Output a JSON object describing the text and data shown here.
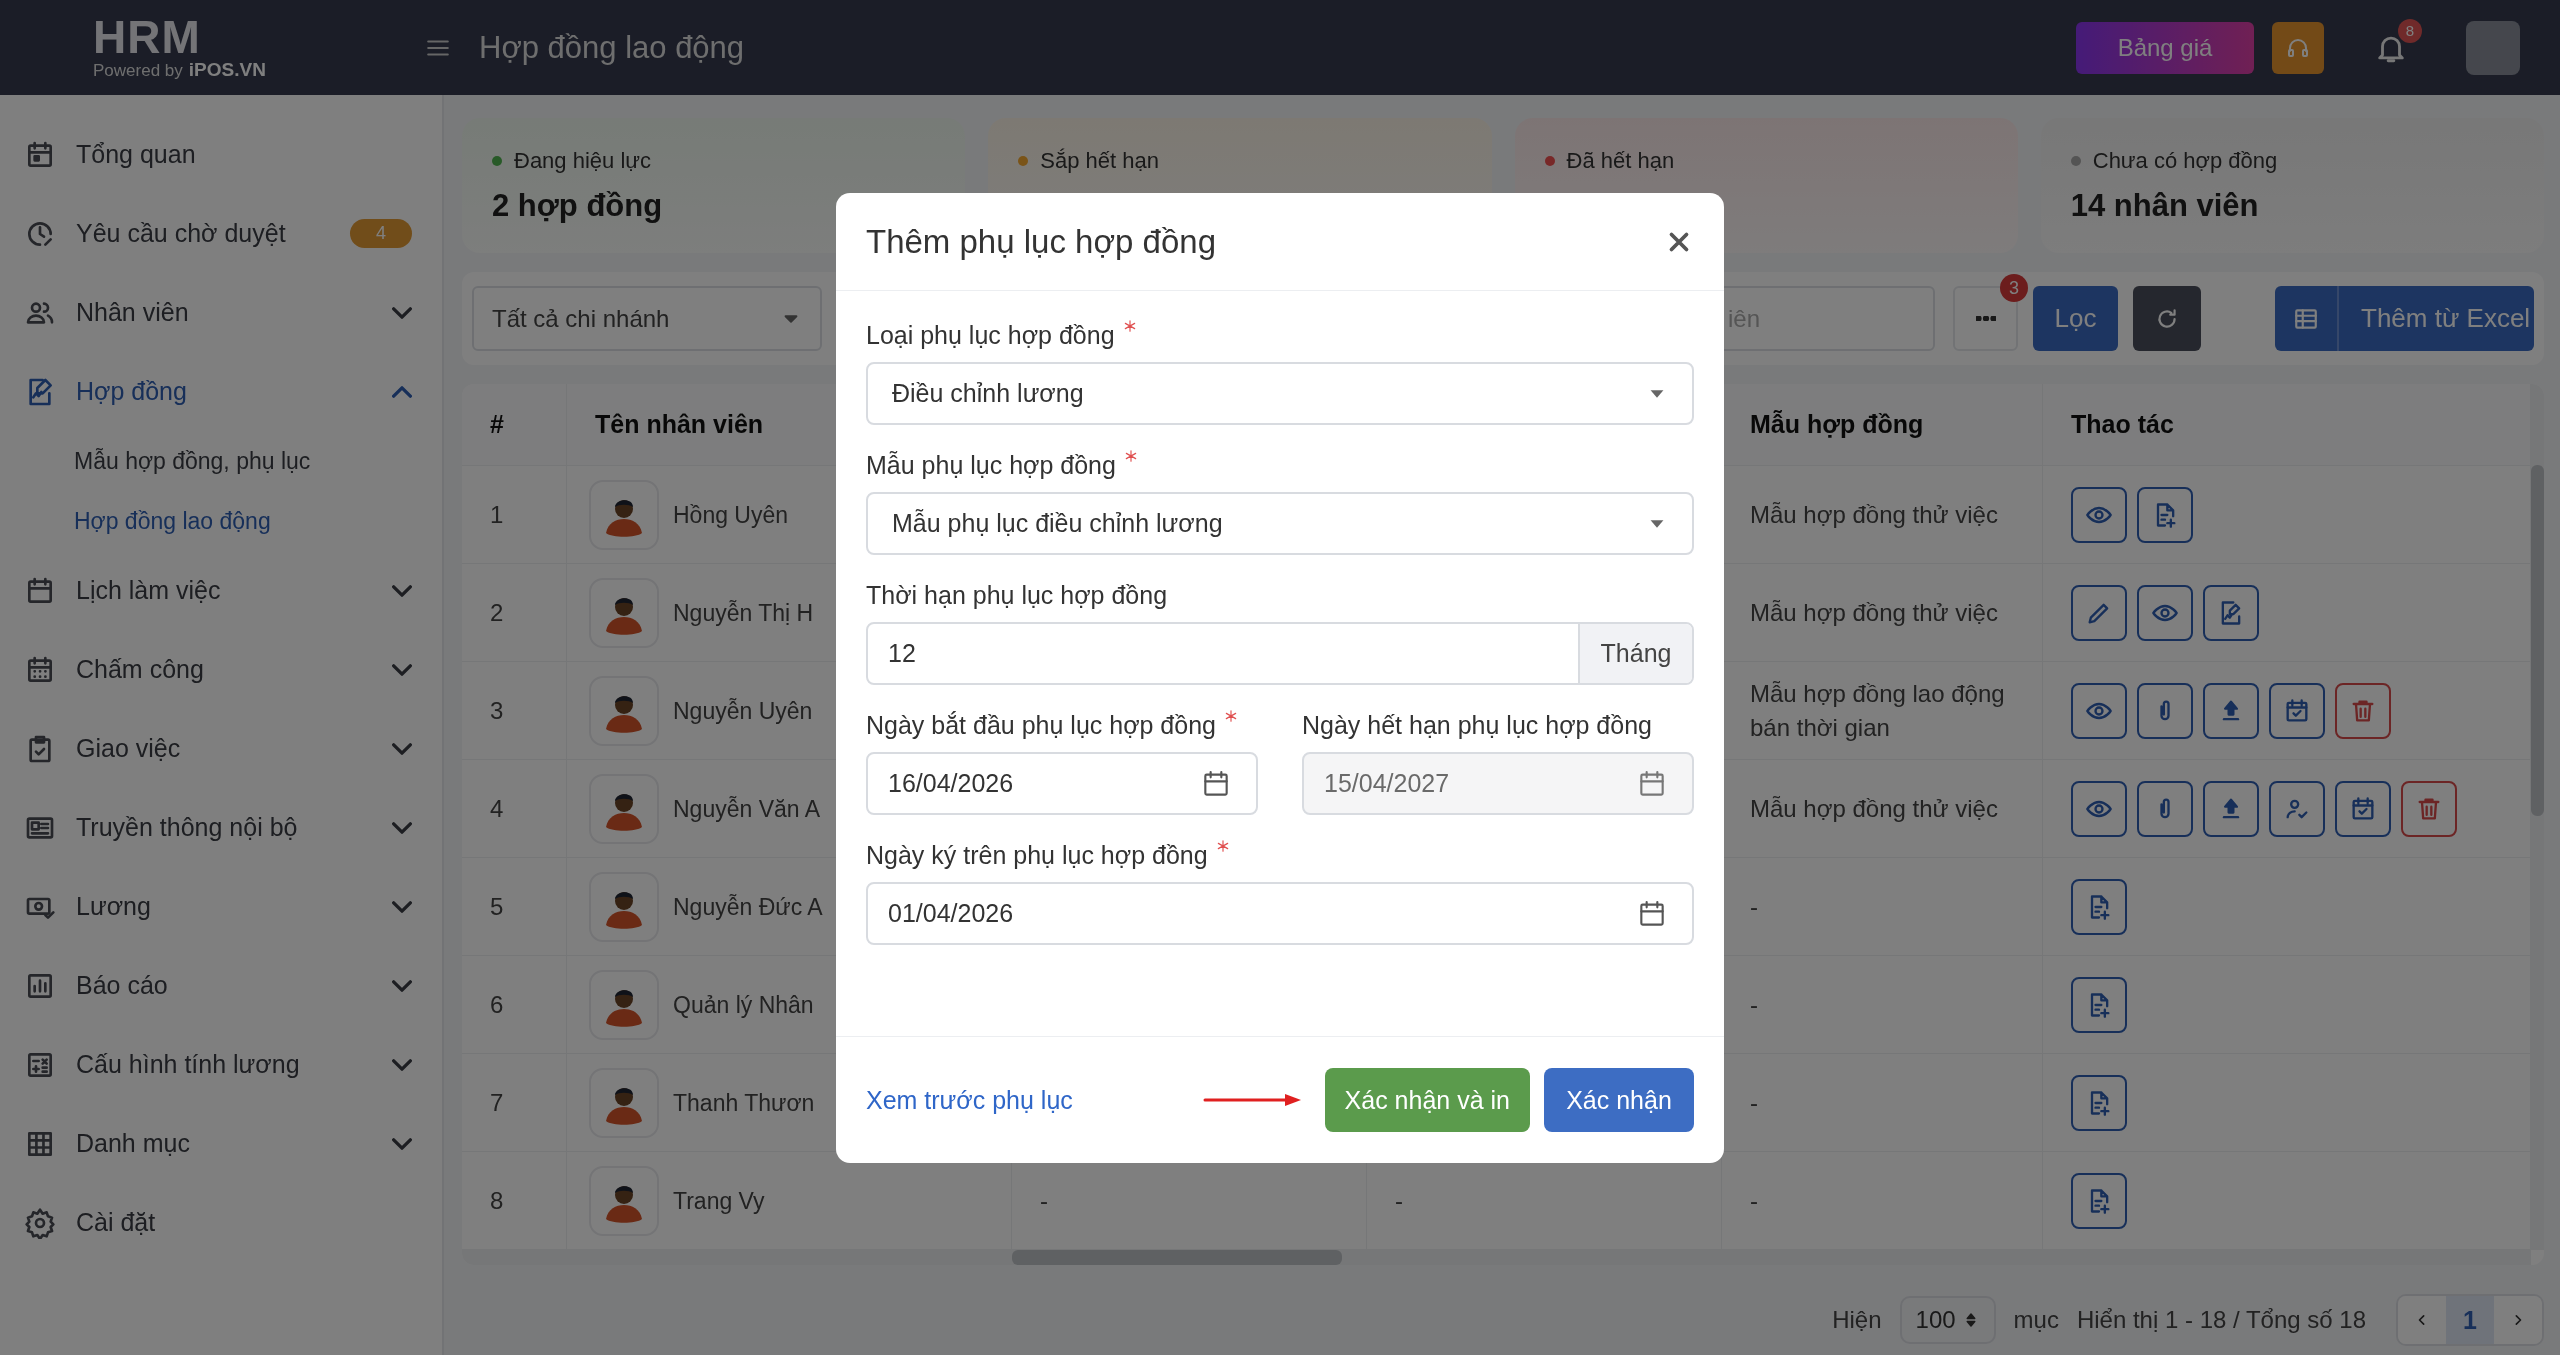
{
  "app": {
    "logo": "HRM",
    "powered_by": "Powered by",
    "brand": "iPOS.VN"
  },
  "header": {
    "title": "Hợp đồng lao động",
    "pricing_button": "Bảng giá",
    "notification_count": "8"
  },
  "sidebar": {
    "items": [
      {
        "label": "Tổng quan",
        "kind": "link",
        "selected": false
      },
      {
        "label": "Yêu cầu chờ duyệt",
        "kind": "link",
        "selected": false,
        "badge": "4"
      },
      {
        "label": "Nhân viên",
        "kind": "group",
        "expanded": false,
        "selected": false
      },
      {
        "label": "Hợp đồng",
        "kind": "group",
        "expanded": true,
        "selected": true,
        "children": [
          {
            "label": "Mẫu hợp đồng, phụ lục",
            "selected": false
          },
          {
            "label": "Hợp đồng lao động",
            "selected": true
          }
        ]
      },
      {
        "label": "Lịch làm việc",
        "kind": "group",
        "expanded": false,
        "selected": false
      },
      {
        "label": "Chấm công",
        "kind": "group",
        "expanded": false,
        "selected": false
      },
      {
        "label": "Giao việc",
        "kind": "group",
        "expanded": false,
        "selected": false
      },
      {
        "label": "Truyền thông nội bộ",
        "kind": "group",
        "expanded": false,
        "selected": false
      },
      {
        "label": "Lương",
        "kind": "group",
        "expanded": false,
        "selected": false
      },
      {
        "label": "Báo cáo",
        "kind": "group",
        "expanded": false,
        "selected": false
      },
      {
        "label": "Cấu hình tính lương",
        "kind": "group",
        "expanded": false,
        "selected": false
      },
      {
        "label": "Danh mục",
        "kind": "group",
        "expanded": false,
        "selected": false
      },
      {
        "label": "Cài đặt",
        "kind": "link",
        "selected": false
      }
    ]
  },
  "stats": [
    {
      "label": "Đang hiệu lực",
      "value": "2 hợp đồng",
      "color": "#285a28"
    },
    {
      "label": "Sắp hết hạn",
      "color": "#7a5418"
    },
    {
      "label": "Đã hết hạn",
      "color": "#782828"
    },
    {
      "label": "Chưa có hợp đồng",
      "value": "14 nhân viên",
      "color": "#545454"
    }
  ],
  "toolbar": {
    "branch_select": "Tất cả chi nhánh",
    "search_placeholder": "iên",
    "filter_count": "3",
    "filter_button": "Lọc",
    "import_button": "Thêm từ Excel"
  },
  "table": {
    "columns": [
      {
        "label": "#"
      },
      {
        "label": "Tên nhân viên"
      },
      {
        "label": "Mẫu hợp đồng"
      },
      {
        "label": "Thao tác"
      }
    ],
    "rows": [
      {
        "number": "1",
        "name": "Hồng Uyên",
        "template": "Mẫu hợp đồng thử việc",
        "actions": [
          {
            "kind": "view"
          },
          {
            "kind": "add"
          }
        ]
      },
      {
        "number": "2",
        "name": "Nguyễn Thị H",
        "template": "Mẫu hợp đồng thử việc",
        "actions": [
          {
            "kind": "edit"
          },
          {
            "kind": "view"
          },
          {
            "kind": "sign"
          }
        ]
      },
      {
        "number": "3",
        "name": "Nguyễn Uyên",
        "template": "Mẫu hợp đồng lao động bán thời gian",
        "actions": [
          {
            "kind": "view"
          },
          {
            "kind": "attach"
          },
          {
            "kind": "upload"
          },
          {
            "kind": "schedule"
          },
          {
            "kind": "delete"
          }
        ]
      },
      {
        "number": "4",
        "name": "Nguyễn Văn A",
        "template": "Mẫu hợp đồng thử việc",
        "actions": [
          {
            "kind": "view"
          },
          {
            "kind": "attach"
          },
          {
            "kind": "upload"
          },
          {
            "kind": "approve"
          },
          {
            "kind": "schedule"
          },
          {
            "kind": "delete"
          }
        ]
      },
      {
        "number": "5",
        "name": "Nguyễn Đức A",
        "template": "-",
        "actions": [
          {
            "kind": "add"
          }
        ]
      },
      {
        "number": "6",
        "name": "Quản lý Nhân",
        "template": "-",
        "actions": [
          {
            "kind": "add"
          }
        ]
      },
      {
        "number": "7",
        "name": "Thanh Thươn",
        "template": "-",
        "actions": [
          {
            "kind": "add"
          }
        ]
      },
      {
        "number": "8",
        "name": "Trang Vy",
        "column_3": "-",
        "column_4": "-",
        "template": "-",
        "actions": [
          {
            "kind": "add"
          }
        ]
      }
    ]
  },
  "pagination": {
    "show_label": "Hiện",
    "page_size": "100",
    "unit": "mục",
    "summary": "Hiển thị 1 - 18 / Tổng số 18",
    "pages": [
      {
        "label": "1",
        "selected": true
      }
    ]
  },
  "modal": {
    "title": "Thêm phụ lục hợp đồng",
    "rows": [
      {
        "fields": [
          {
            "kind": "select",
            "label": "Loại phụ lục hợp đồng",
            "required": true,
            "value": "Điều chỉnh lương"
          }
        ]
      },
      {
        "fields": [
          {
            "kind": "select",
            "label": "Mẫu phụ lục hợp đồng",
            "required": true,
            "value": "Mẫu phụ lục điều chỉnh lương"
          }
        ]
      },
      {
        "fields": [
          {
            "kind": "number",
            "label": "Thời hạn phụ lục hợp đồng",
            "required": false,
            "value": "12",
            "unit": "Tháng"
          }
        ]
      },
      {
        "fields": [
          {
            "kind": "date",
            "label": "Ngày bắt đầu phụ lục hợp đồng",
            "required": true,
            "value": "16/04/2026",
            "disabled": false
          },
          {
            "kind": "date",
            "label": "Ngày hết hạn phụ lục hợp đồng",
            "required": false,
            "value": "15/04/2027",
            "disabled": true
          }
        ]
      },
      {
        "fields": [
          {
            "kind": "date",
            "label": "Ngày ký trên phụ lục hợp đồng",
            "required": true,
            "value": "01/04/2026",
            "disabled": false
          }
        ]
      }
    ],
    "preview_link": "Xem trước phụ lục",
    "buttons": [
      {
        "label": "Xác nhận và in",
        "kind": "success"
      },
      {
        "label": "Xác nhận",
        "kind": "primary"
      }
    ]
  }
}
